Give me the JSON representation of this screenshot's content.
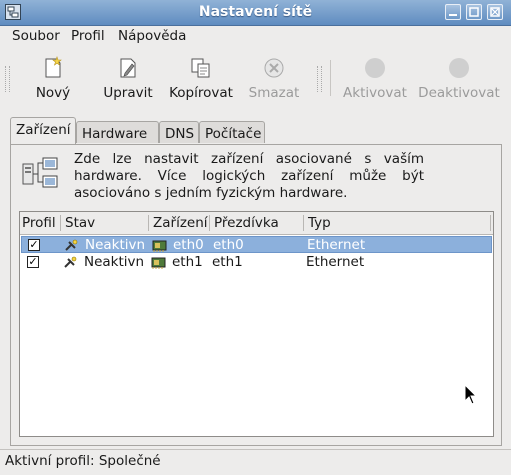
{
  "window": {
    "title": "Nastavení sítě"
  },
  "menu": [
    "Soubor",
    "Profil",
    "Nápověda"
  ],
  "toolbar": {
    "new": "Nový",
    "edit": "Upravit",
    "copy": "Kopírovat",
    "delete": "Smazat",
    "activate": "Aktivovat",
    "deactivate": "Deaktivovat"
  },
  "tabs": [
    "Zařízení",
    "Hardware",
    "DNS",
    "Počítače"
  ],
  "description": "Zde lze nastavit zařízení asociované s vaším hardware. Více logických zařízení může být asociováno s jedním fyzickým hardware.",
  "table": {
    "columns": [
      "Profil",
      "Stav",
      "Zařízení",
      "Přezdívka",
      "Typ"
    ],
    "rows": [
      {
        "checked": true,
        "status": "Neaktivn",
        "device": "eth0",
        "nickname": "eth0",
        "type": "Ethernet",
        "selected": true
      },
      {
        "checked": true,
        "status": "Neaktivn",
        "device": "eth1",
        "nickname": "eth1",
        "type": "Ethernet",
        "selected": false
      }
    ]
  },
  "status_bar": "Aktivní profil: Společné"
}
